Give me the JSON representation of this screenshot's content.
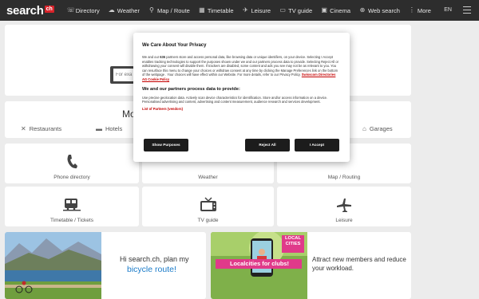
{
  "header": {
    "logo_text": "search",
    "logo_badge": "ch",
    "nav": [
      {
        "icon": "directory-icon",
        "glyph": "☏",
        "label": "Directory"
      },
      {
        "icon": "weather-icon",
        "glyph": "☁",
        "label": "Weather"
      },
      {
        "icon": "map-pin-icon",
        "glyph": "⚲",
        "label": "Map / Route"
      },
      {
        "icon": "timetable-icon",
        "glyph": "▦",
        "label": "Timetable"
      },
      {
        "icon": "leisure-icon",
        "glyph": "✈",
        "label": "Leisure"
      },
      {
        "icon": "tv-icon",
        "glyph": "▭",
        "label": "TV guide"
      },
      {
        "icon": "cinema-icon",
        "glyph": "▣",
        "label": "Cinema"
      },
      {
        "icon": "web-search-icon",
        "glyph": "⊕",
        "label": "Web search"
      },
      {
        "icon": "more-icon",
        "glyph": "⋮",
        "label": "More"
      }
    ],
    "language": "EN"
  },
  "search": {
    "placeholder": "For exa"
  },
  "categories": {
    "title": "Mo",
    "items": [
      {
        "icon": "cutlery-icon",
        "label": "Restaurants"
      },
      {
        "icon": "bed-icon",
        "label": "Hotels"
      },
      {
        "icon": "garage-icon",
        "label": "Garages"
      }
    ]
  },
  "tiles": [
    {
      "name": "phone-directory",
      "label": "Phone directory"
    },
    {
      "name": "weather",
      "label": "Weather"
    },
    {
      "name": "map-routing",
      "label": "Map / Routing"
    },
    {
      "name": "timetable-tickets",
      "label": "Timetable / Tickets"
    },
    {
      "name": "tv-guide",
      "label": "TV guide"
    },
    {
      "name": "leisure",
      "label": "Leisure"
    }
  ],
  "promos": [
    {
      "line1": "Hi search.ch, plan my",
      "link": "bicycle route!"
    },
    {
      "image_text": "Localcities for clubs!",
      "logo_line1": "LOCAL",
      "logo_line2": "CITIES",
      "text": "Attract new members and reduce your workload."
    }
  ],
  "cookie_modal": {
    "title": "We Care About Your Privacy",
    "body_1": "We and our",
    "partners_count": "636",
    "body_2": "partners store and access personal data, like browsing data or unique identifiers, on your device. Selecting I Accept enables tracking technologies to support the purposes shown under we and our partners process data to provide. Selecting Reject All or withdrawing your consent will disable them. If trackers are disabled, some content and ads you see may not be as relevant to you. You can resurface this menu to change your choices or withdraw consent at any time by clicking the Manage Preferences link on the bottom of the webpage . Your choices will have effect within our Website. For more details, refer to our Privacy Policy.",
    "policy_link": "Swisscom Directories AG Cookie Policy",
    "subtitle": "We and our partners process data to provide:",
    "purposes": "Use precise geolocation data. Actively scan device characteristics for identification. Store and/or access information on a device. Personalised advertising and content, advertising and content measurement, audience research and services development.",
    "vendors_link": "List of Partners (vendors)",
    "btn_purposes": "Show Purposes",
    "btn_reject": "Reject All",
    "btn_accept": "I Accept"
  },
  "colors": {
    "topbar": "#2d2d2d",
    "brand_red": "#d8232a",
    "link_blue": "#1a7bc9"
  }
}
